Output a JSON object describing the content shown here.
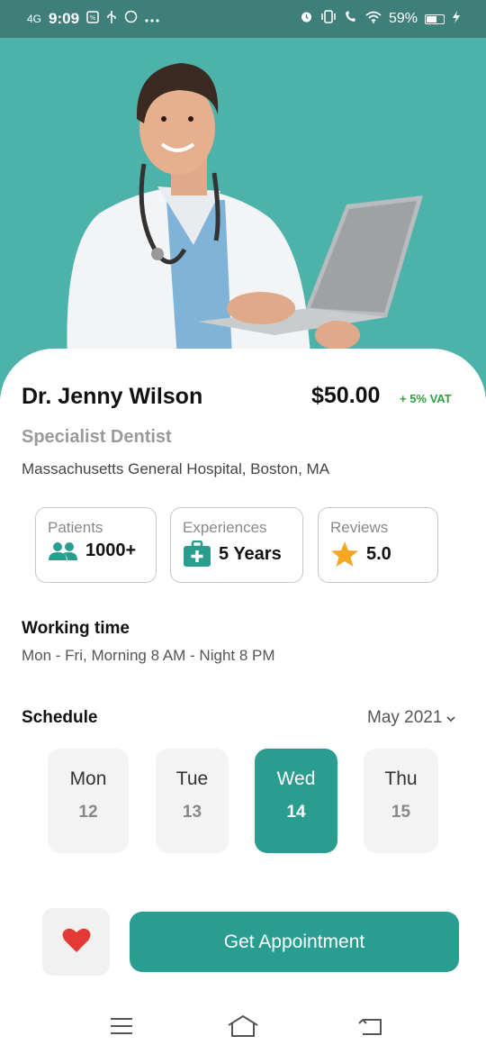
{
  "status_bar": {
    "network": "4G",
    "time": "9:09",
    "battery_percent": "59%",
    "battery_level": 0.59,
    "icons": [
      "notification-icon",
      "usb-icon",
      "whatsapp-icon",
      "more-dots-icon",
      "alarm-icon",
      "vibrate-icon",
      "wifi-call-icon",
      "wifi-icon",
      "battery-icon",
      "charging-icon"
    ]
  },
  "colors": {
    "header_teal": "#4db3aa",
    "accent": "#2a9d91",
    "vat_green": "#2ea043",
    "heart": "#e53935",
    "star": "#f5a623"
  },
  "doctor": {
    "name": "Dr. Jenny Wilson",
    "price": "$50.00",
    "vat": "+ 5% VAT",
    "specialty": "Specialist Dentist",
    "hospital": "Massachusetts General Hospital, Boston, MA"
  },
  "stats": [
    {
      "label": "Patients",
      "value": "1000+",
      "icon": "people-icon"
    },
    {
      "label": "Experiences",
      "value": "5 Years",
      "icon": "medical-bag-icon"
    },
    {
      "label": "Reviews",
      "value": "5.0",
      "icon": "star-icon"
    }
  ],
  "working_time": {
    "title": "Working time",
    "hours": "Mon - Fri, Morning 8 AM - Night 8 PM"
  },
  "schedule": {
    "title": "Schedule",
    "month": "May 2021",
    "days": [
      {
        "name": "Mon",
        "date": "12",
        "selected": false
      },
      {
        "name": "Tue",
        "date": "13",
        "selected": false
      },
      {
        "name": "Wed",
        "date": "14",
        "selected": true
      },
      {
        "name": "Thu",
        "date": "15",
        "selected": false
      }
    ]
  },
  "actions": {
    "favorite_icon": "heart-icon",
    "appointment_label": "Get Appointment"
  },
  "nav_bar": {
    "icons": [
      "menu-icon",
      "home-icon",
      "back-icon"
    ]
  }
}
